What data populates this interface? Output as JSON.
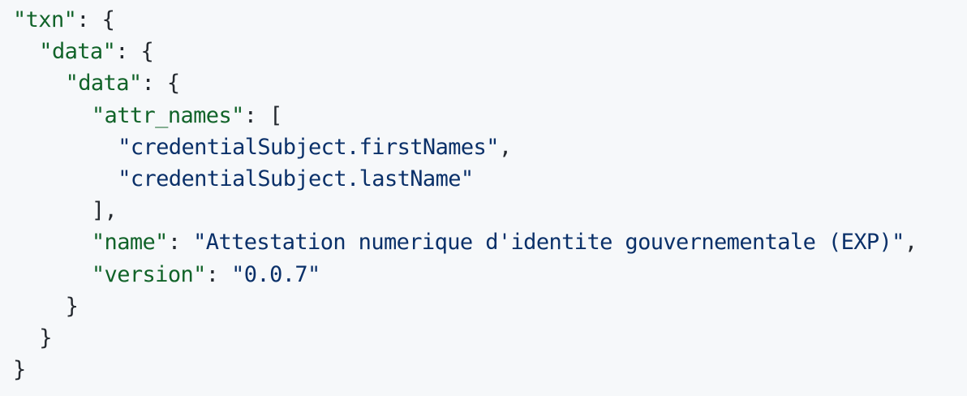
{
  "code": {
    "txn_key": "\"txn\"",
    "outer_data_key": "\"data\"",
    "inner_data_key": "\"data\"",
    "attr_names_key": "\"attr_names\"",
    "attr_values": [
      "\"credentialSubject.firstNames\"",
      "\"credentialSubject.lastName\""
    ],
    "name_key": "\"name\"",
    "name_value": "\"Attestation numerique d'identite gouvernementale (EXP)\"",
    "version_key": "\"version\"",
    "version_value": "\"0.0.7\"",
    "colon_open_brace": ": {",
    "colon_open_bracket": ": [",
    "colon": ": ",
    "comma": ",",
    "close_bracket_comma": "],",
    "close_brace": "}"
  },
  "colors": {
    "background": "#f6f8fa",
    "key": "#116329",
    "string": "#0a3069",
    "punctuation": "#24292f"
  }
}
